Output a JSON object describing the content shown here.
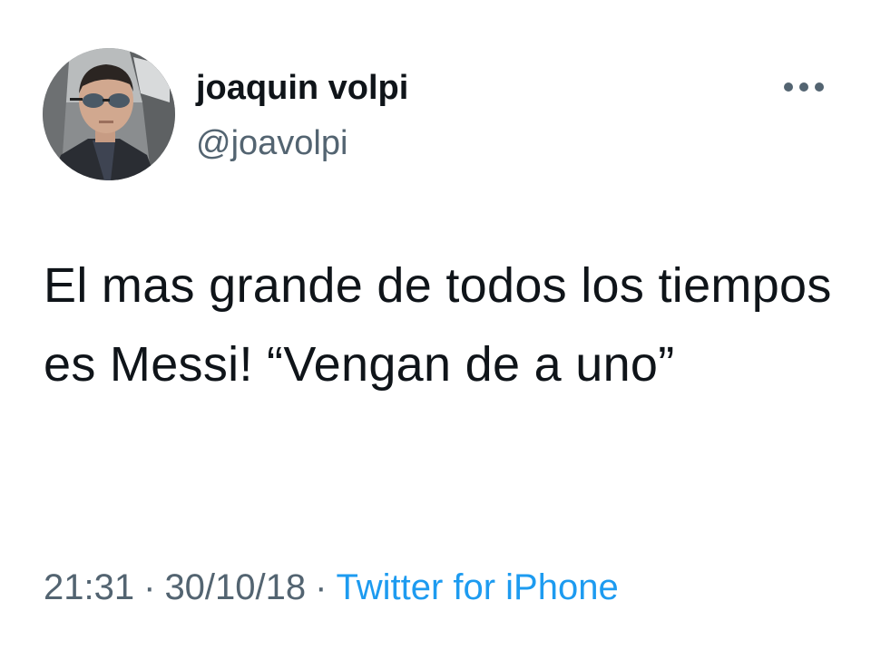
{
  "user": {
    "display_name": "joaquin volpi",
    "handle": "@joavolpi",
    "avatar_icon": "user-avatar-photo"
  },
  "tweet": {
    "text": "El mas grande de todos los tiempos es Messi! “Vengan de a uno”"
  },
  "meta": {
    "time": "21:31",
    "separator": "·",
    "date": "30/10/18",
    "source": "Twitter for iPhone"
  },
  "icons": {
    "more": "more-options-icon"
  },
  "colors": {
    "text_primary": "#0f1419",
    "text_secondary": "#536471",
    "link": "#1d9bf0",
    "background": "#ffffff"
  }
}
